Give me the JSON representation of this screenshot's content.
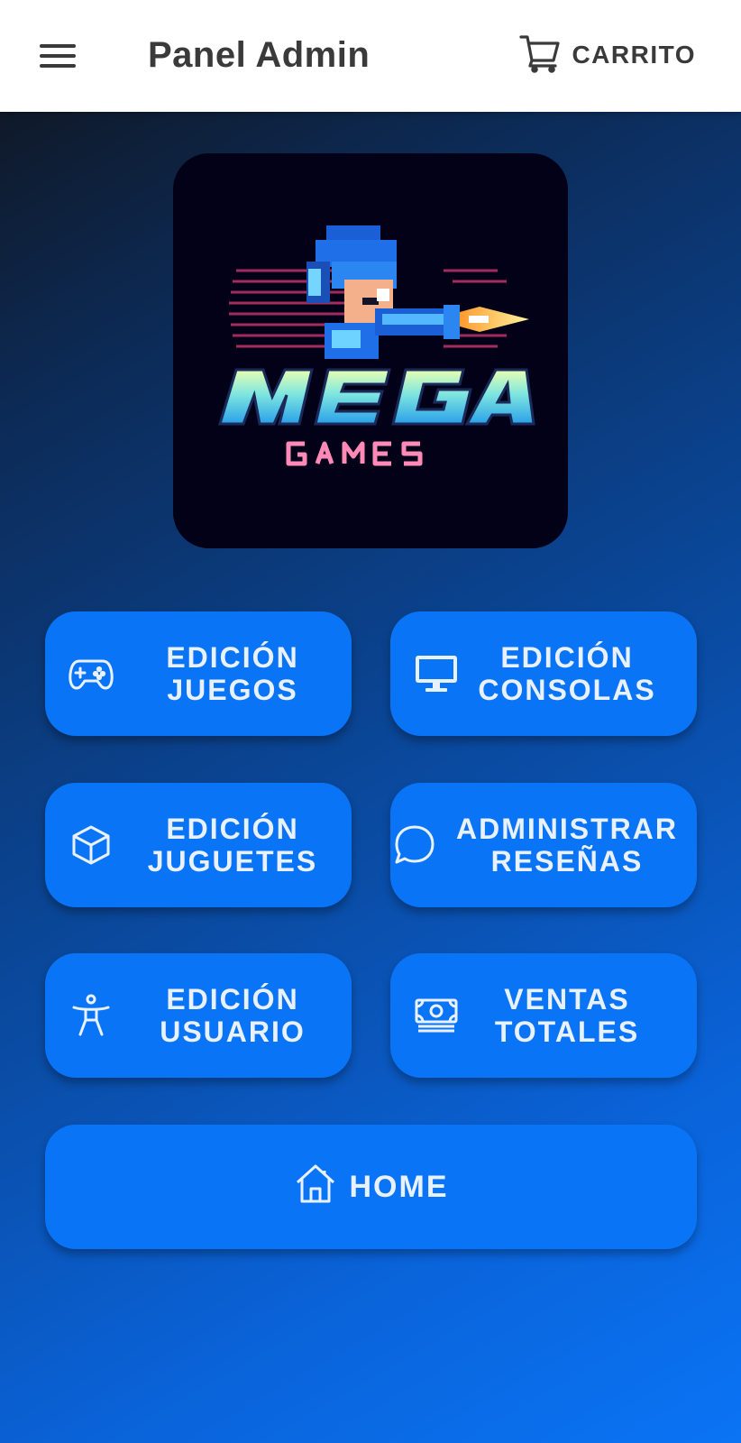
{
  "header": {
    "title": "Panel Admin",
    "cart_label": "CARRITO",
    "menu_icon": "hamburger-menu-icon",
    "cart_icon": "shopping-cart-icon"
  },
  "logo": {
    "line1": "MEGA",
    "line2": "GAMES"
  },
  "buttons": [
    {
      "line1": "EDICIÓN",
      "line2": "JUEGOS",
      "icon": "gamepad-icon"
    },
    {
      "line1": "EDICIÓN",
      "line2": "CONSOLAS",
      "icon": "monitor-icon"
    },
    {
      "line1": "EDICIÓN",
      "line2": "JUGUETES",
      "icon": "cube-icon"
    },
    {
      "line1": "ADMINISTRAR",
      "line2": "RESEÑAS",
      "icon": "chat-bubble-icon"
    },
    {
      "line1": "EDICIÓN",
      "line2": "USUARIO",
      "icon": "accessibility-person-icon"
    },
    {
      "line1": "VENTAS",
      "line2": "TOTALES",
      "icon": "cash-icon"
    }
  ],
  "home": {
    "label": "HOME",
    "icon": "home-icon"
  },
  "colors": {
    "button": "#0a74f7",
    "header_bg": "#ffffff",
    "header_text": "#3a3a3a",
    "button_text": "#e9f1ff"
  }
}
